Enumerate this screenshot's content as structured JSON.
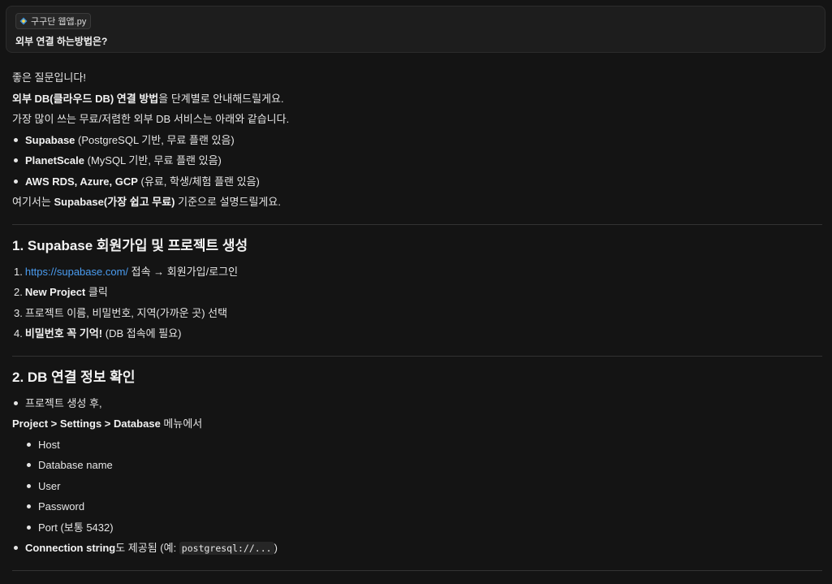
{
  "user_message": {
    "attachment_name": "구구단 웹앱.py",
    "question": "외부 연결 하는방법은?"
  },
  "answer": {
    "intro1": "좋은 질문입니다!",
    "intro2_bold": "외부 DB(클라우드 DB) 연결 방법",
    "intro2_rest": "을 단계별로 안내해드릴게요.",
    "intro3": "가장 많이 쓰는 무료/저렴한 외부 DB 서비스는 아래와 같습니다.",
    "services": [
      {
        "name": "Supabase",
        "desc": " (PostgreSQL 기반, 무료 플랜 있음)"
      },
      {
        "name": "PlanetScale",
        "desc": " (MySQL 기반, 무료 플랜 있음)"
      },
      {
        "name": "AWS RDS, Azure, GCP",
        "desc": " (유료, 학생/체험 플랜 있음)"
      }
    ],
    "basis_prefix": "여기서는 ",
    "basis_bold": "Supabase(가장 쉽고 무료)",
    "basis_suffix": " 기준으로 설명드릴게요.",
    "section1": {
      "heading": "1. Supabase 회원가입 및 프로젝트 생성",
      "steps": {
        "s1_num": "1.",
        "s1_link": "https://supabase.com/",
        "s1_rest": " 접속 → 회원가입/로그인",
        "s2_num": "2.",
        "s2_bold": "New Project",
        "s2_rest": " 클릭",
        "s3_num": "3.",
        "s3_text": "프로젝트 이름, 비밀번호, 지역(가까운 곳) 선택",
        "s4_num": "4.",
        "s4_bold": "비밀번호 꼭 기억!",
        "s4_rest": " (DB 접속에 필요)"
      }
    },
    "section2": {
      "heading": "2. DB 연결 정보 확인",
      "bullet1": "프로젝트 생성 후,",
      "menu_path": "Project > Settings > Database",
      "menu_suffix": " 메뉴에서",
      "fields": [
        "Host",
        "Database name",
        "User",
        "Password",
        "Port (보통 5432)"
      ],
      "conn_bold": "Connection string",
      "conn_rest": "도 제공됨 (예: ",
      "conn_code": "postgresql://...",
      "conn_close": ")"
    }
  }
}
